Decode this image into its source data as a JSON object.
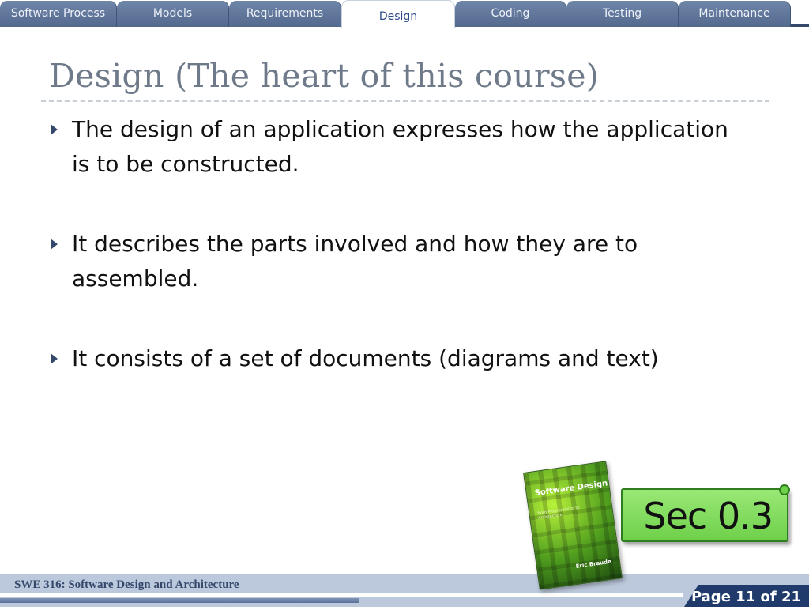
{
  "tabs": [
    {
      "label": "Software Process",
      "active": false
    },
    {
      "label": "Models",
      "active": false
    },
    {
      "label": "Requirements",
      "active": false
    },
    {
      "label": "Design",
      "active": true
    },
    {
      "label": "Coding",
      "active": false
    },
    {
      "label": "Testing",
      "active": false
    },
    {
      "label": "Maintenance",
      "active": false
    }
  ],
  "slide": {
    "title": "Design (The heart of this course)",
    "bullets": [
      "The design of an application expresses how the application is to be constructed.",
      "It describes the parts involved and how they are to assembled.",
      "It consists of a set of documents (diagrams and text)"
    ]
  },
  "book": {
    "title": "Software Design",
    "subtitle": "from Programming to Architecture",
    "author": "Eric Braude"
  },
  "section_badge": "Sec 0.3",
  "footer": {
    "course": "SWE 316: Software Design and Architecture",
    "page": "Page 11 of 21"
  },
  "colors": {
    "tab_bg": "#5f7699",
    "tab_active_text": "#2a4a86",
    "title": "#6e7a8a",
    "bullet_mark": "#34486b",
    "badge": "#7fdc58",
    "footer_bg": "#bcc9dc",
    "page_bg": "#1f3a6b"
  }
}
